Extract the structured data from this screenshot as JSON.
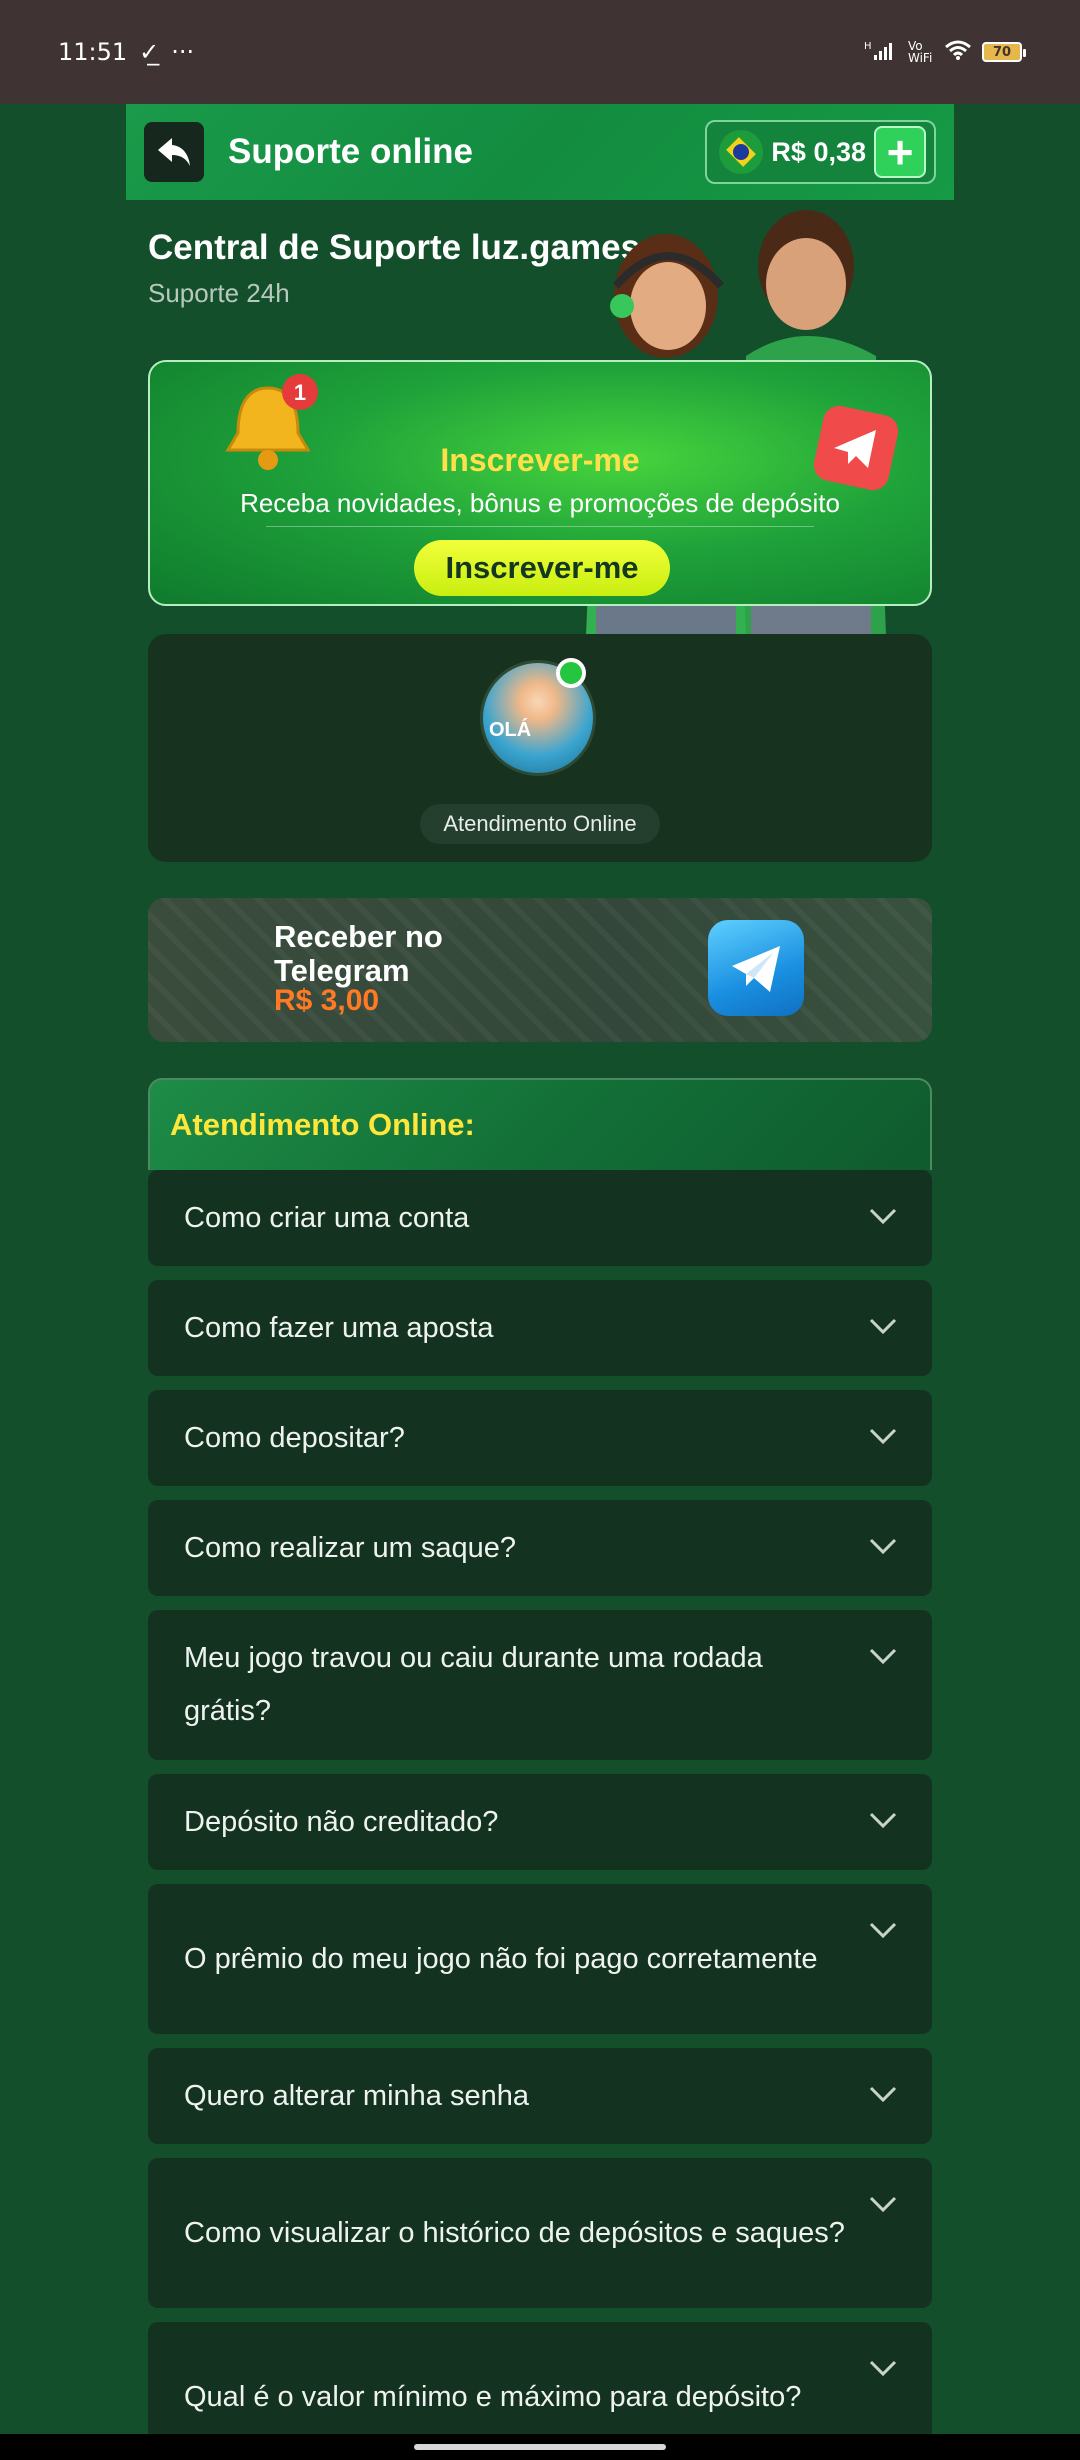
{
  "status_bar": {
    "time": "11:51",
    "network": "H",
    "volte": "Vo WiFi",
    "battery": "70"
  },
  "header": {
    "title": "Suporte online",
    "balance": "R$ 0,38",
    "add_label": "+"
  },
  "hero": {
    "title": "Central de Suporte luz.games",
    "subtitle": "Suporte 24h"
  },
  "promo": {
    "title": "Inscrever-me",
    "description": "Receba novidades, bônus e promoções de depósito",
    "button": "Inscrever-me",
    "badge": "1"
  },
  "support": {
    "avatar_text": "OLÁ",
    "label": "Atendimento Online"
  },
  "telegram": {
    "title": "Receber no Telegram",
    "amount": "R$ 3,00"
  },
  "faq": {
    "heading": "Atendimento Online:",
    "items": [
      {
        "question": "Como criar uma conta",
        "lines": 1
      },
      {
        "question": "Como fazer uma aposta",
        "lines": 1
      },
      {
        "question": "Como depositar?",
        "lines": 1
      },
      {
        "question": "Como realizar um saque?",
        "lines": 1
      },
      {
        "question": "Meu jogo travou ou caiu durante uma rodada grátis?",
        "lines": 2
      },
      {
        "question": "Depósito não creditado?",
        "lines": 1
      },
      {
        "question": "O prêmio do meu jogo não foi pago corretamente",
        "lines": 2
      },
      {
        "question": "Quero alterar minha senha",
        "lines": 1
      },
      {
        "question": "Como visualizar o histórico de depósitos e saques?",
        "lines": 2
      },
      {
        "question": "Qual é o valor mínimo e máximo para depósito?",
        "lines": 2
      }
    ]
  },
  "colors": {
    "background": "#124f2a",
    "header": "#169a45",
    "accent_yellow": "#ffe04a",
    "amount_orange": "#ff7a22"
  }
}
